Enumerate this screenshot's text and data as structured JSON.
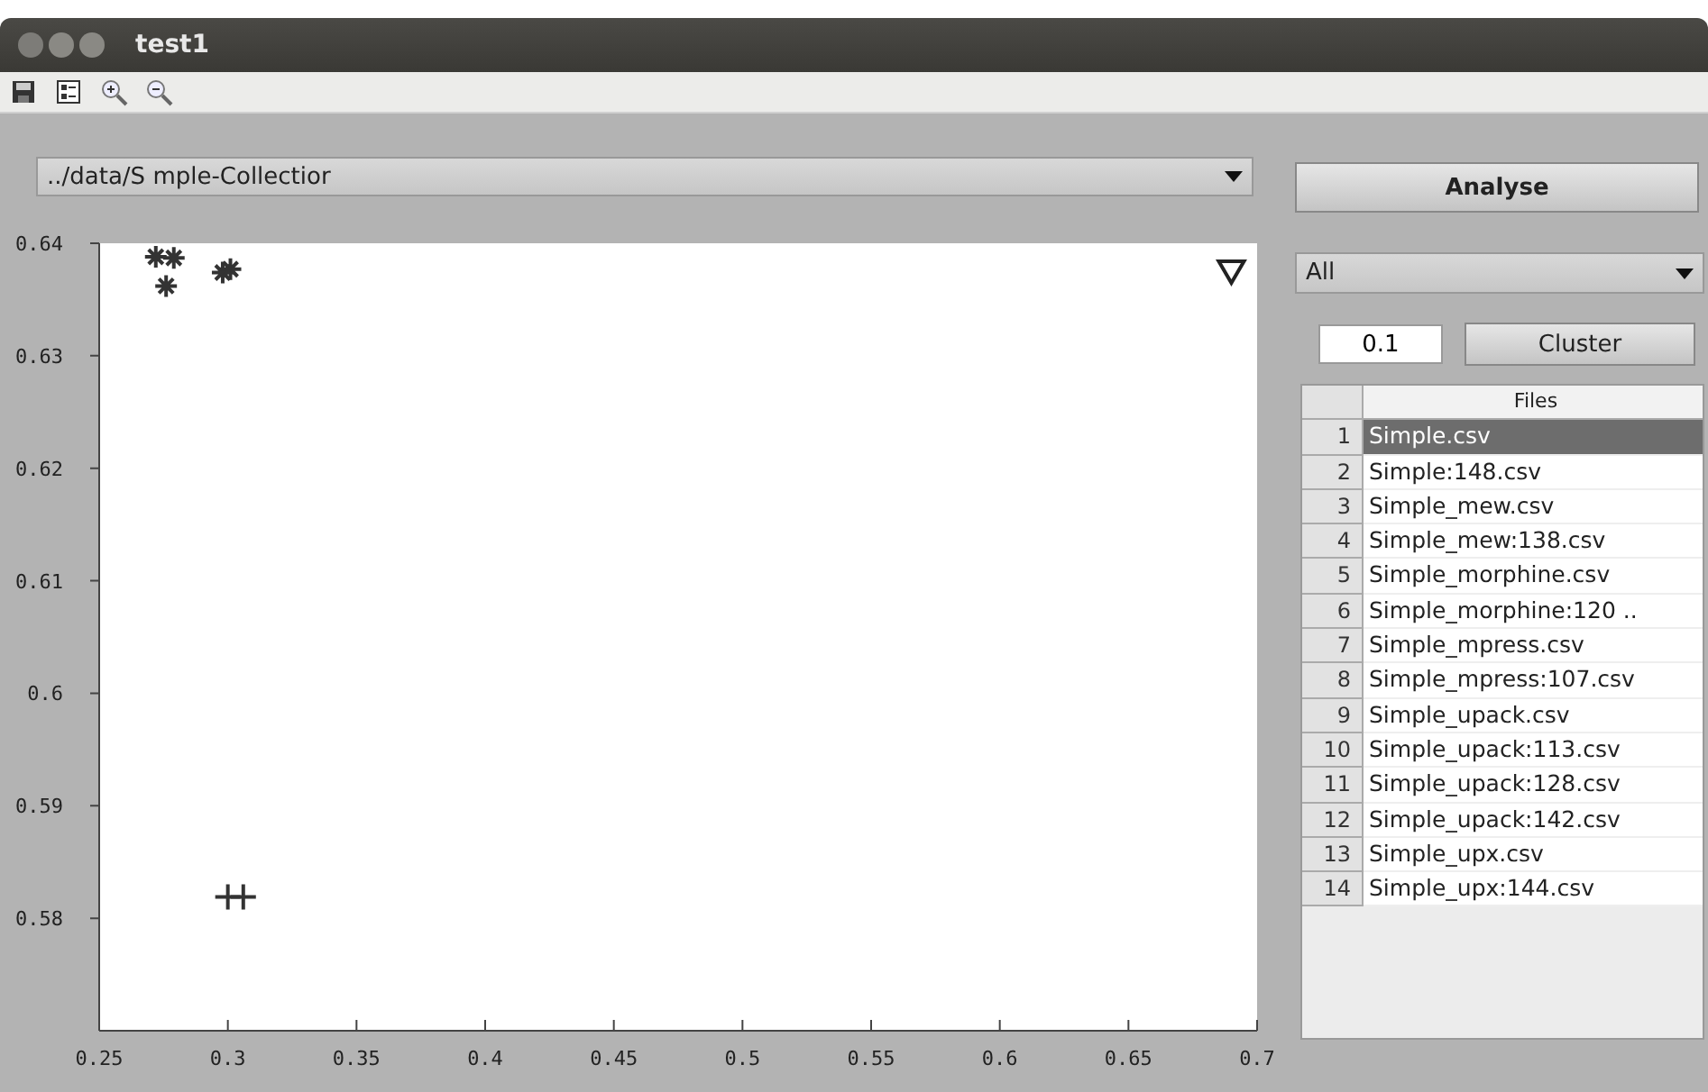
{
  "window": {
    "title": "test1"
  },
  "toolbar": [
    {
      "kind": "save"
    },
    {
      "kind": "legend"
    },
    {
      "kind": "zoom-in"
    },
    {
      "kind": "zoom-out"
    }
  ],
  "path_select": {
    "value": "../data/S mple-Collectior"
  },
  "analyse_button": "Analyse",
  "filter_select": {
    "value": "All"
  },
  "threshold_field": {
    "value": "0.1"
  },
  "cluster_button": "Cluster",
  "files_table": {
    "columns": [
      "Files"
    ],
    "rows": [
      {
        "index": "1",
        "file": "Simple.csv",
        "selected": true
      },
      {
        "index": "2",
        "file": "Simple:148.csv",
        "selected": false
      },
      {
        "index": "3",
        "file": "Simple_mew.csv",
        "selected": false
      },
      {
        "index": "4",
        "file": "Simple_mew:138.csv",
        "selected": false
      },
      {
        "index": "5",
        "file": "Simple_morphine.csv",
        "selected": false
      },
      {
        "index": "6",
        "file": "Simple_morphine:120 ..",
        "selected": false
      },
      {
        "index": "7",
        "file": "Simple_mpress.csv",
        "selected": false
      },
      {
        "index": "8",
        "file": "Simple_mpress:107.csv",
        "selected": false
      },
      {
        "index": "9",
        "file": "Simple_upack.csv",
        "selected": false
      },
      {
        "index": "10",
        "file": "Simple_upack:113.csv",
        "selected": false
      },
      {
        "index": "11",
        "file": "Simple_upack:128.csv",
        "selected": false
      },
      {
        "index": "12",
        "file": "Simple_upack:142.csv",
        "selected": false
      },
      {
        "index": "13",
        "file": "Simple_upx.csv",
        "selected": false
      },
      {
        "index": "14",
        "file": "Simple_upx:144.csv",
        "selected": false
      }
    ]
  },
  "chart_data": {
    "type": "scatter",
    "xlim": [
      0.25,
      0.7
    ],
    "ylim": [
      0.57,
      0.64
    ],
    "xticks": [
      0.25,
      0.3,
      0.35,
      0.4,
      0.45,
      0.5,
      0.55,
      0.6,
      0.65,
      0.7
    ],
    "yticks": [
      0.58,
      0.59,
      0.6,
      0.61,
      0.62,
      0.63,
      0.64
    ],
    "x": [
      0.272,
      0.276,
      0.279,
      0.298,
      0.3,
      0.301,
      0.306,
      0.69
    ],
    "series": [
      {
        "color": "#333333",
        "values": [
          0.6388,
          0.6362,
          0.6387,
          0.6374,
          null,
          0.6377,
          null,
          null
        ]
      },
      {
        "color": "#333333",
        "values": [
          null,
          null,
          null,
          null,
          0.5819,
          null,
          0.5819,
          null
        ]
      },
      {
        "color": "#222222",
        "values": [
          null,
          null,
          null,
          null,
          null,
          null,
          null,
          0.6376
        ]
      }
    ]
  }
}
